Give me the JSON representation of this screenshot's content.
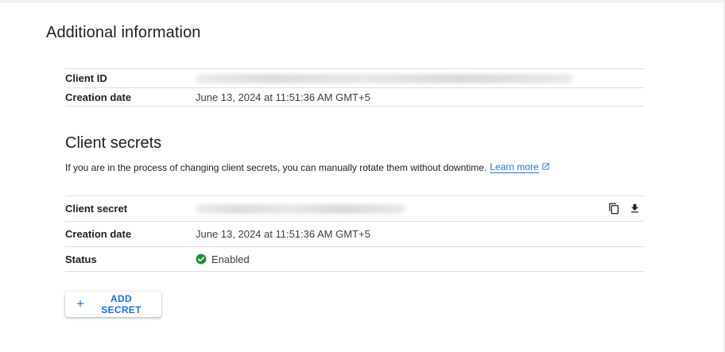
{
  "additional_info": {
    "title": "Additional information",
    "rows": [
      {
        "label": "Client ID",
        "value": ""
      },
      {
        "label": "Creation date",
        "value": "June 13, 2024 at 11:51:36 AM GMT+5"
      }
    ]
  },
  "client_secrets": {
    "title": "Client secrets",
    "description": "If you are in the process of changing client secrets, you can manually rotate them without downtime.",
    "learn_more": "Learn more",
    "rows": [
      {
        "label": "Client secret",
        "value": ""
      },
      {
        "label": "Creation date",
        "value": "June 13, 2024 at 11:51:36 AM GMT+5"
      },
      {
        "label": "Status",
        "value": "Enabled"
      }
    ],
    "add_button": "ADD SECRET"
  },
  "colors": {
    "accent": "#1a73e8",
    "status_green": "#1e8e3e",
    "divider": "#dadce0"
  },
  "icons": {
    "copy": "copy-icon",
    "download": "download-icon",
    "status": "check-circle-icon",
    "external": "open-in-new-icon",
    "add": "plus-icon"
  }
}
